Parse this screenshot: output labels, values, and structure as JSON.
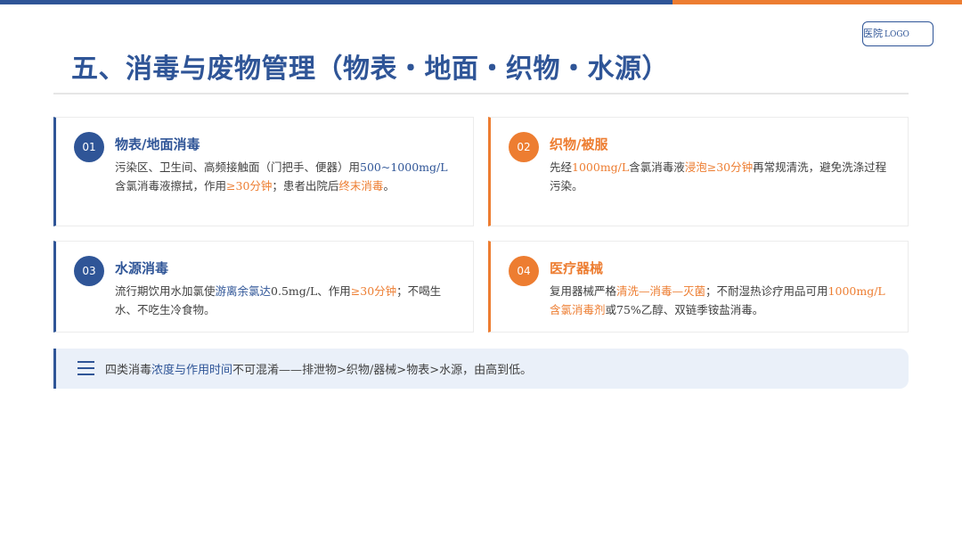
{
  "header": {
    "logo_text": "医院",
    "logo_suffix": "LOGO",
    "title": "五、消毒与废物管理（物表・地面・织物・水源）"
  },
  "cards": [
    {
      "number": "01",
      "title": "物表/地面消毒",
      "body": [
        {
          "text": "污染区、卫生间、高频接触面（门把手、便器）用",
          "style": "plain"
        },
        {
          "text": "500~1000mg/L",
          "style": "blue"
        },
        {
          "text": "含氯消毒液擦拭，作用",
          "style": "plain"
        },
        {
          "text": "≥30分钟",
          "style": "orange"
        },
        {
          "text": "；患者出院后",
          "style": "plain"
        },
        {
          "text": "终末消毒",
          "style": "orange"
        },
        {
          "text": "。",
          "style": "plain"
        }
      ]
    },
    {
      "number": "02",
      "title": "织物/被服",
      "body": [
        {
          "text": "先经",
          "style": "plain"
        },
        {
          "text": "1000mg/L",
          "style": "orange"
        },
        {
          "text": "含氯消毒液",
          "style": "plain"
        },
        {
          "text": "浸泡≥30分钟",
          "style": "orange"
        },
        {
          "text": "再常规清洗，避免洗涤过程污染。",
          "style": "plain"
        }
      ]
    },
    {
      "number": "03",
      "title": "水源消毒",
      "body": [
        {
          "text": "流行期饮用水加氯使",
          "style": "plain"
        },
        {
          "text": "游离余氯达",
          "style": "blue"
        },
        {
          "text": "0.5mg/L、作用",
          "style": "plain"
        },
        {
          "text": "≥30分钟",
          "style": "orange"
        },
        {
          "text": "；不喝生水、不吃生冷食物。",
          "style": "plain"
        }
      ]
    },
    {
      "number": "04",
      "title": "医疗器械",
      "body": [
        {
          "text": "复用器械严格",
          "style": "plain"
        },
        {
          "text": "清洗—消毒—灭菌",
          "style": "orange"
        },
        {
          "text": "；不耐湿热诊疗用品可用",
          "style": "plain"
        },
        {
          "text": "1000mg/L含氯消毒剂",
          "style": "orange"
        },
        {
          "text": "或75%乙醇、双链季铵盐消毒。",
          "style": "plain"
        }
      ]
    }
  ],
  "note": {
    "icon": "menu-icon",
    "segments": [
      {
        "text": "四类消毒",
        "style": "plain"
      },
      {
        "text": "浓度与作用时间",
        "style": "blue"
      },
      {
        "text": "不可混淆——排泄物>织物/器械>物表>水源，由高到低。",
        "style": "plain"
      }
    ]
  },
  "colors": {
    "primary": "#2f5597",
    "accent": "#ed7d31",
    "note_bg": "#eaf0f9"
  }
}
